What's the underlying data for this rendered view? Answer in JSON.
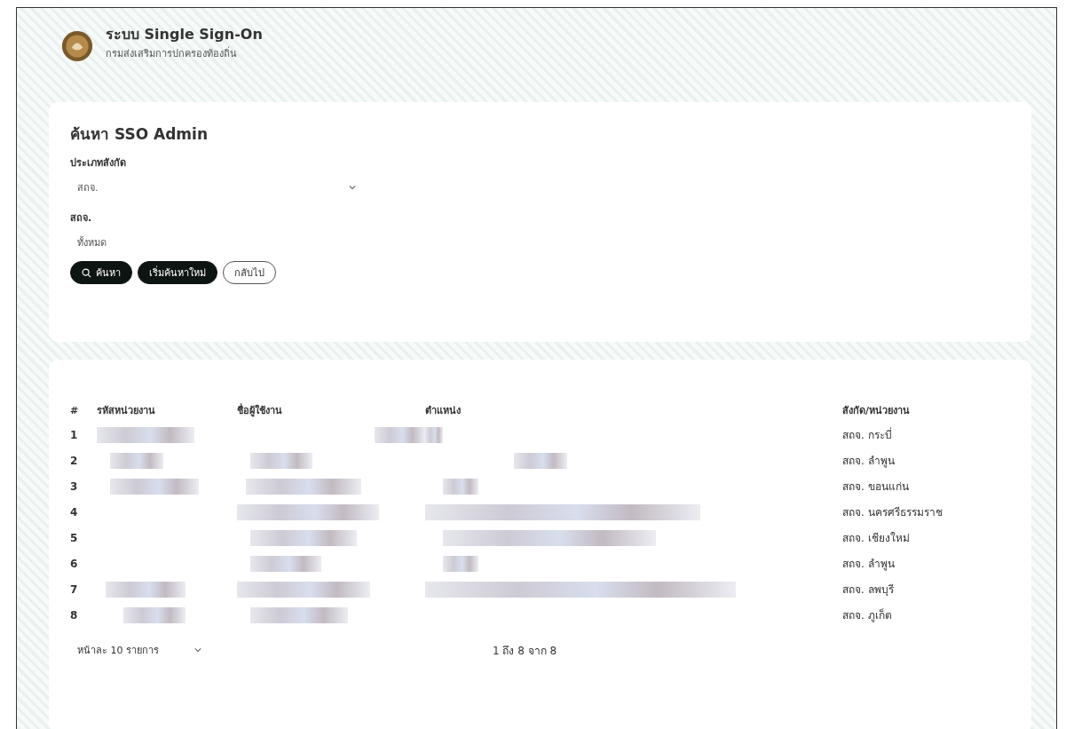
{
  "header": {
    "title": "ระบบ Single Sign-On",
    "subtitle": "กรมส่งเสริมการปกครองท้องถิ่น"
  },
  "search": {
    "title": "ค้นหา SSO Admin",
    "fields": [
      {
        "label": "ประเภทสังกัด",
        "value": "สถจ.",
        "kind": "select"
      },
      {
        "label": "สถจ.",
        "value": "ทั้งหมด",
        "kind": "text"
      }
    ],
    "buttons": [
      {
        "label": "ค้นหา",
        "kind": "search"
      },
      {
        "label": "เริ่มค้นหาใหม่",
        "kind": "primary"
      },
      {
        "label": "กลับไป",
        "kind": "outline"
      }
    ]
  },
  "table": {
    "columns": [
      "#",
      "รหัสหน่วยงาน",
      "ชื่อผู้ใช้งาน",
      "ตำแหน่ง",
      "สังกัด/หน่วยงาน"
    ],
    "rows": [
      {
        "number": "1",
        "unit": "สถจ. กระบี่"
      },
      {
        "number": "2",
        "unit": "สถจ. ลำพูน"
      },
      {
        "number": "3",
        "unit": "สถจ. ขอนแก่น"
      },
      {
        "number": "4",
        "unit": "สถจ. นครศรีธรรมราช"
      },
      {
        "number": "5",
        "unit": "สถจ. เชียงใหม่"
      },
      {
        "number": "6",
        "unit": "สถจ. ลำพูน"
      },
      {
        "number": "7",
        "unit": "สถจ. ลพบุรี"
      },
      {
        "number": "8",
        "unit": "สถจ. ภูเก็ต"
      }
    ]
  },
  "footer": {
    "page_size": "หน้าละ 10 รายการ",
    "range": "1 ถึง 8 จาก 8"
  }
}
